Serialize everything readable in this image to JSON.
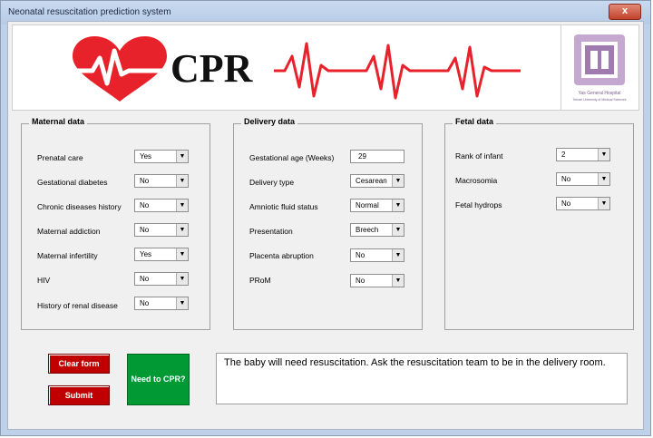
{
  "window": {
    "title": "Neonatal resuscitation prediction system",
    "close_glyph": "x"
  },
  "banner": {
    "logo_text": "CPR",
    "accent_color": "#e8222a",
    "hospital_logo_icon": "university-seal-icon",
    "hospital_logo_caption": "Yas General Hospital",
    "hospital_logo_subcaption": "Tehran University of Medical Sciences"
  },
  "maternal": {
    "title": "Maternal data",
    "fields": [
      {
        "label": "Prenatal care",
        "value": "Yes"
      },
      {
        "label": "Gestational diabetes",
        "value": "No"
      },
      {
        "label": "Chronic diseases history",
        "value": "No"
      },
      {
        "label": "Maternal addiction",
        "value": "No"
      },
      {
        "label": "Maternal infertility",
        "value": "Yes"
      },
      {
        "label": "HIV",
        "value": "No"
      },
      {
        "label": "History of renal disease",
        "value": "No"
      }
    ]
  },
  "delivery": {
    "title": "Delivery data",
    "gestational_age": {
      "label": "Gestational age (Weeks)",
      "value": "29"
    },
    "fields": [
      {
        "label": "Delivery type",
        "value": "Cesarean"
      },
      {
        "label": "Amniotic fluid status",
        "value": "Normal"
      },
      {
        "label": "Presentation",
        "value": "Breech"
      },
      {
        "label": "Placenta abruption",
        "value": "No"
      },
      {
        "label": "PRoM",
        "value": "No"
      }
    ]
  },
  "fetal": {
    "title": "Fetal data",
    "fields": [
      {
        "label": "Rank of infant",
        "value": "2"
      },
      {
        "label": "Macrosomia",
        "value": "No"
      },
      {
        "label": "Fetal hydrops",
        "value": "No"
      }
    ]
  },
  "buttons": {
    "clear": "Clear form",
    "submit": "Submit",
    "need_cpr": "Need to CPR?"
  },
  "result": {
    "text": "The baby will need resuscitation. Ask the resuscitation team to be in the delivery room."
  },
  "dropdown_glyph": "▼"
}
